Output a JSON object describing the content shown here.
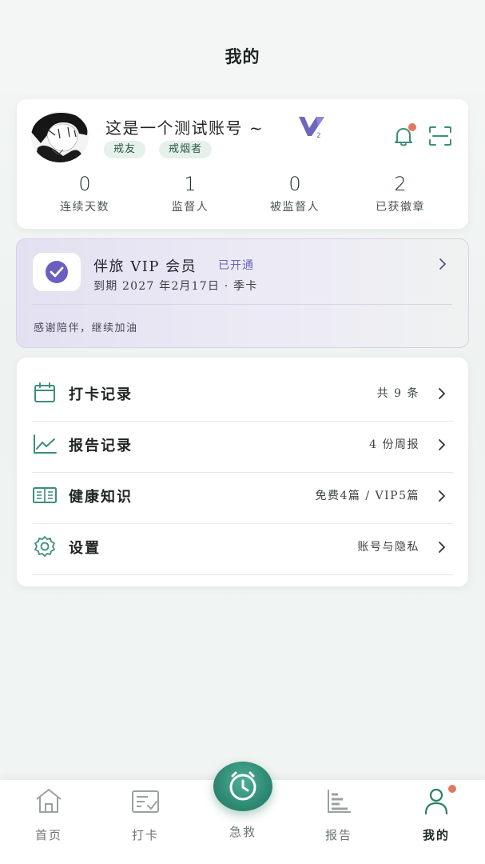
{
  "header": {
    "title": "我的"
  },
  "profile": {
    "username": "这是一个测试账号 ~",
    "vip_level": "V",
    "vip_level_num": "2",
    "tags": [
      "戒友",
      "戒烟者"
    ],
    "stats": [
      {
        "value": "0",
        "label": "连续天数"
      },
      {
        "value": "1",
        "label": "监督人"
      },
      {
        "value": "0",
        "label": "被监督人"
      },
      {
        "value": "2",
        "label": "已获徽章"
      }
    ],
    "bell_has_notification": true
  },
  "vip": {
    "title": "伴旅 VIP 会员",
    "status": "已开通",
    "expire": "到期 2027 年2月17日 · 季卡",
    "note": "感谢陪伴，继续加油"
  },
  "menu": [
    {
      "icon": "calendar-icon",
      "label": "打卡记录",
      "value": "共 9 条"
    },
    {
      "icon": "trend-chart-icon",
      "label": "报告记录",
      "value": "4 份周报"
    },
    {
      "icon": "book-icon",
      "label": "健康知识",
      "value": "免费4篇 / VIP5篇"
    },
    {
      "icon": "settings-gear-icon",
      "label": "设置",
      "value": "账号与隐私"
    }
  ],
  "tabbar": {
    "home": "首页",
    "checkin": "打卡",
    "emergency": "急救",
    "report": "报告",
    "me": "我的",
    "active": "me"
  },
  "colors": {
    "accent": "#2f8a73",
    "vip_purple": "#6b62b5",
    "notification_dot": "#e0795f"
  }
}
